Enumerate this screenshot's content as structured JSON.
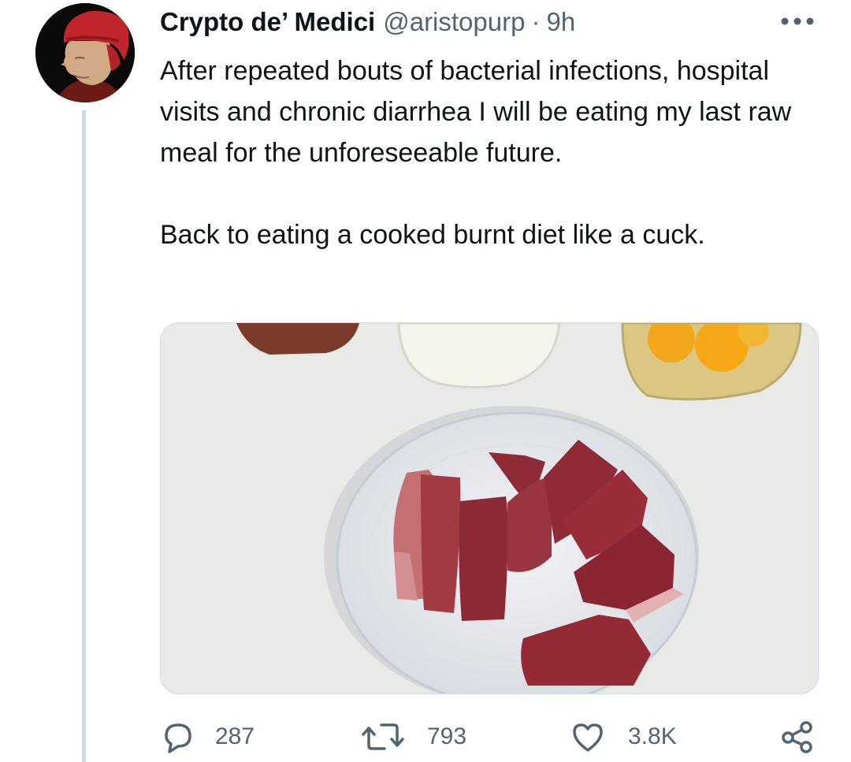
{
  "tweet": {
    "author_name": "Crypto de’ Medici",
    "handle": "@aristopurp",
    "separator": "·",
    "time": "9h",
    "more_icon": "more-horizontal-icon",
    "text_paragraph_1": "After repeated bouts of bacterial infections, hospital visits and chronic diarrhea I will be eating my last raw meal for the unforeseeable future.",
    "text_paragraph_2": "Back to eating a cooked burnt diet like a cuck.",
    "media": {
      "description_icon": "photo-raw-beef-plate"
    },
    "actions": {
      "reply_count": "287",
      "retweet_count": "793",
      "like_count": "3.8K"
    }
  },
  "colors": {
    "text_primary": "#0f1419",
    "text_secondary": "#536471",
    "thread_line": "#cfd9de"
  }
}
